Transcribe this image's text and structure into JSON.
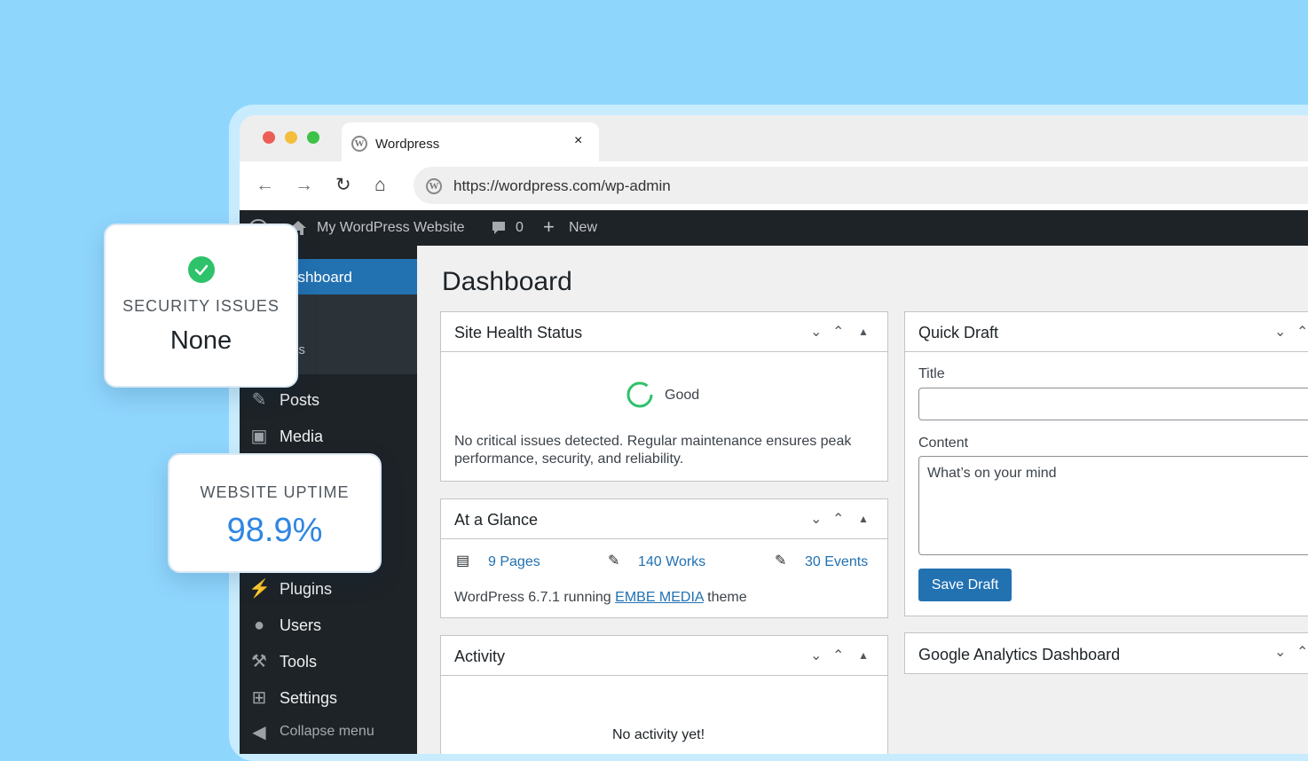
{
  "browser": {
    "tab_title": "Wordpress",
    "tab_close": "×",
    "url": "https://wordpress.com/wp-admin",
    "traffic_lights": [
      "#ec5f57",
      "#f4bd3b",
      "#3cc246"
    ]
  },
  "admin_bar": {
    "site_name": "My WordPress Website",
    "comments_count": "0",
    "new_label": "New"
  },
  "sidebar": {
    "active_label": "ashboard",
    "sub_item_partial": "es",
    "items": [
      {
        "label": "Posts",
        "icon": "pin-icon"
      },
      {
        "label": "Media",
        "icon": "media-icon"
      },
      {
        "label": "Plugins",
        "icon": "plugin-icon"
      },
      {
        "label": "Users",
        "icon": "user-icon"
      },
      {
        "label": "Tools",
        "icon": "wrench-icon"
      },
      {
        "label": "Settings",
        "icon": "settings-icon"
      },
      {
        "label": "Collapse menu",
        "icon": "collapse-icon"
      }
    ]
  },
  "dashboard": {
    "title": "Dashboard",
    "site_health": {
      "title": "Site Health Status",
      "status": "Good",
      "description": "No critical issues detected. Regular maintenance ensures peak performance, security, and reliability."
    },
    "at_a_glance": {
      "title": "At a Glance",
      "pages": "9 Pages",
      "works": "140 Works",
      "events": "30 Events",
      "version_prefix": "WordPress 6.7.1 running ",
      "theme_link": "EMBE MEDIA",
      "version_suffix": " theme"
    },
    "activity": {
      "title": "Activity",
      "empty": "No activity yet!"
    },
    "quick_draft": {
      "title": "Quick Draft",
      "title_label": "Title",
      "title_value": "",
      "content_label": "Content",
      "content_placeholder": "What’s on your mind",
      "save_button": "Save Draft"
    },
    "google_analytics": {
      "title": "Google Analytics Dashboard"
    }
  },
  "overlay_cards": {
    "security": {
      "label": "SECURITY ISSUES",
      "value": "None",
      "accent": "#2ec26a"
    },
    "uptime": {
      "label": "WEBSITE UPTIME",
      "value": "98.9%",
      "accent": "#2f86e2"
    }
  }
}
